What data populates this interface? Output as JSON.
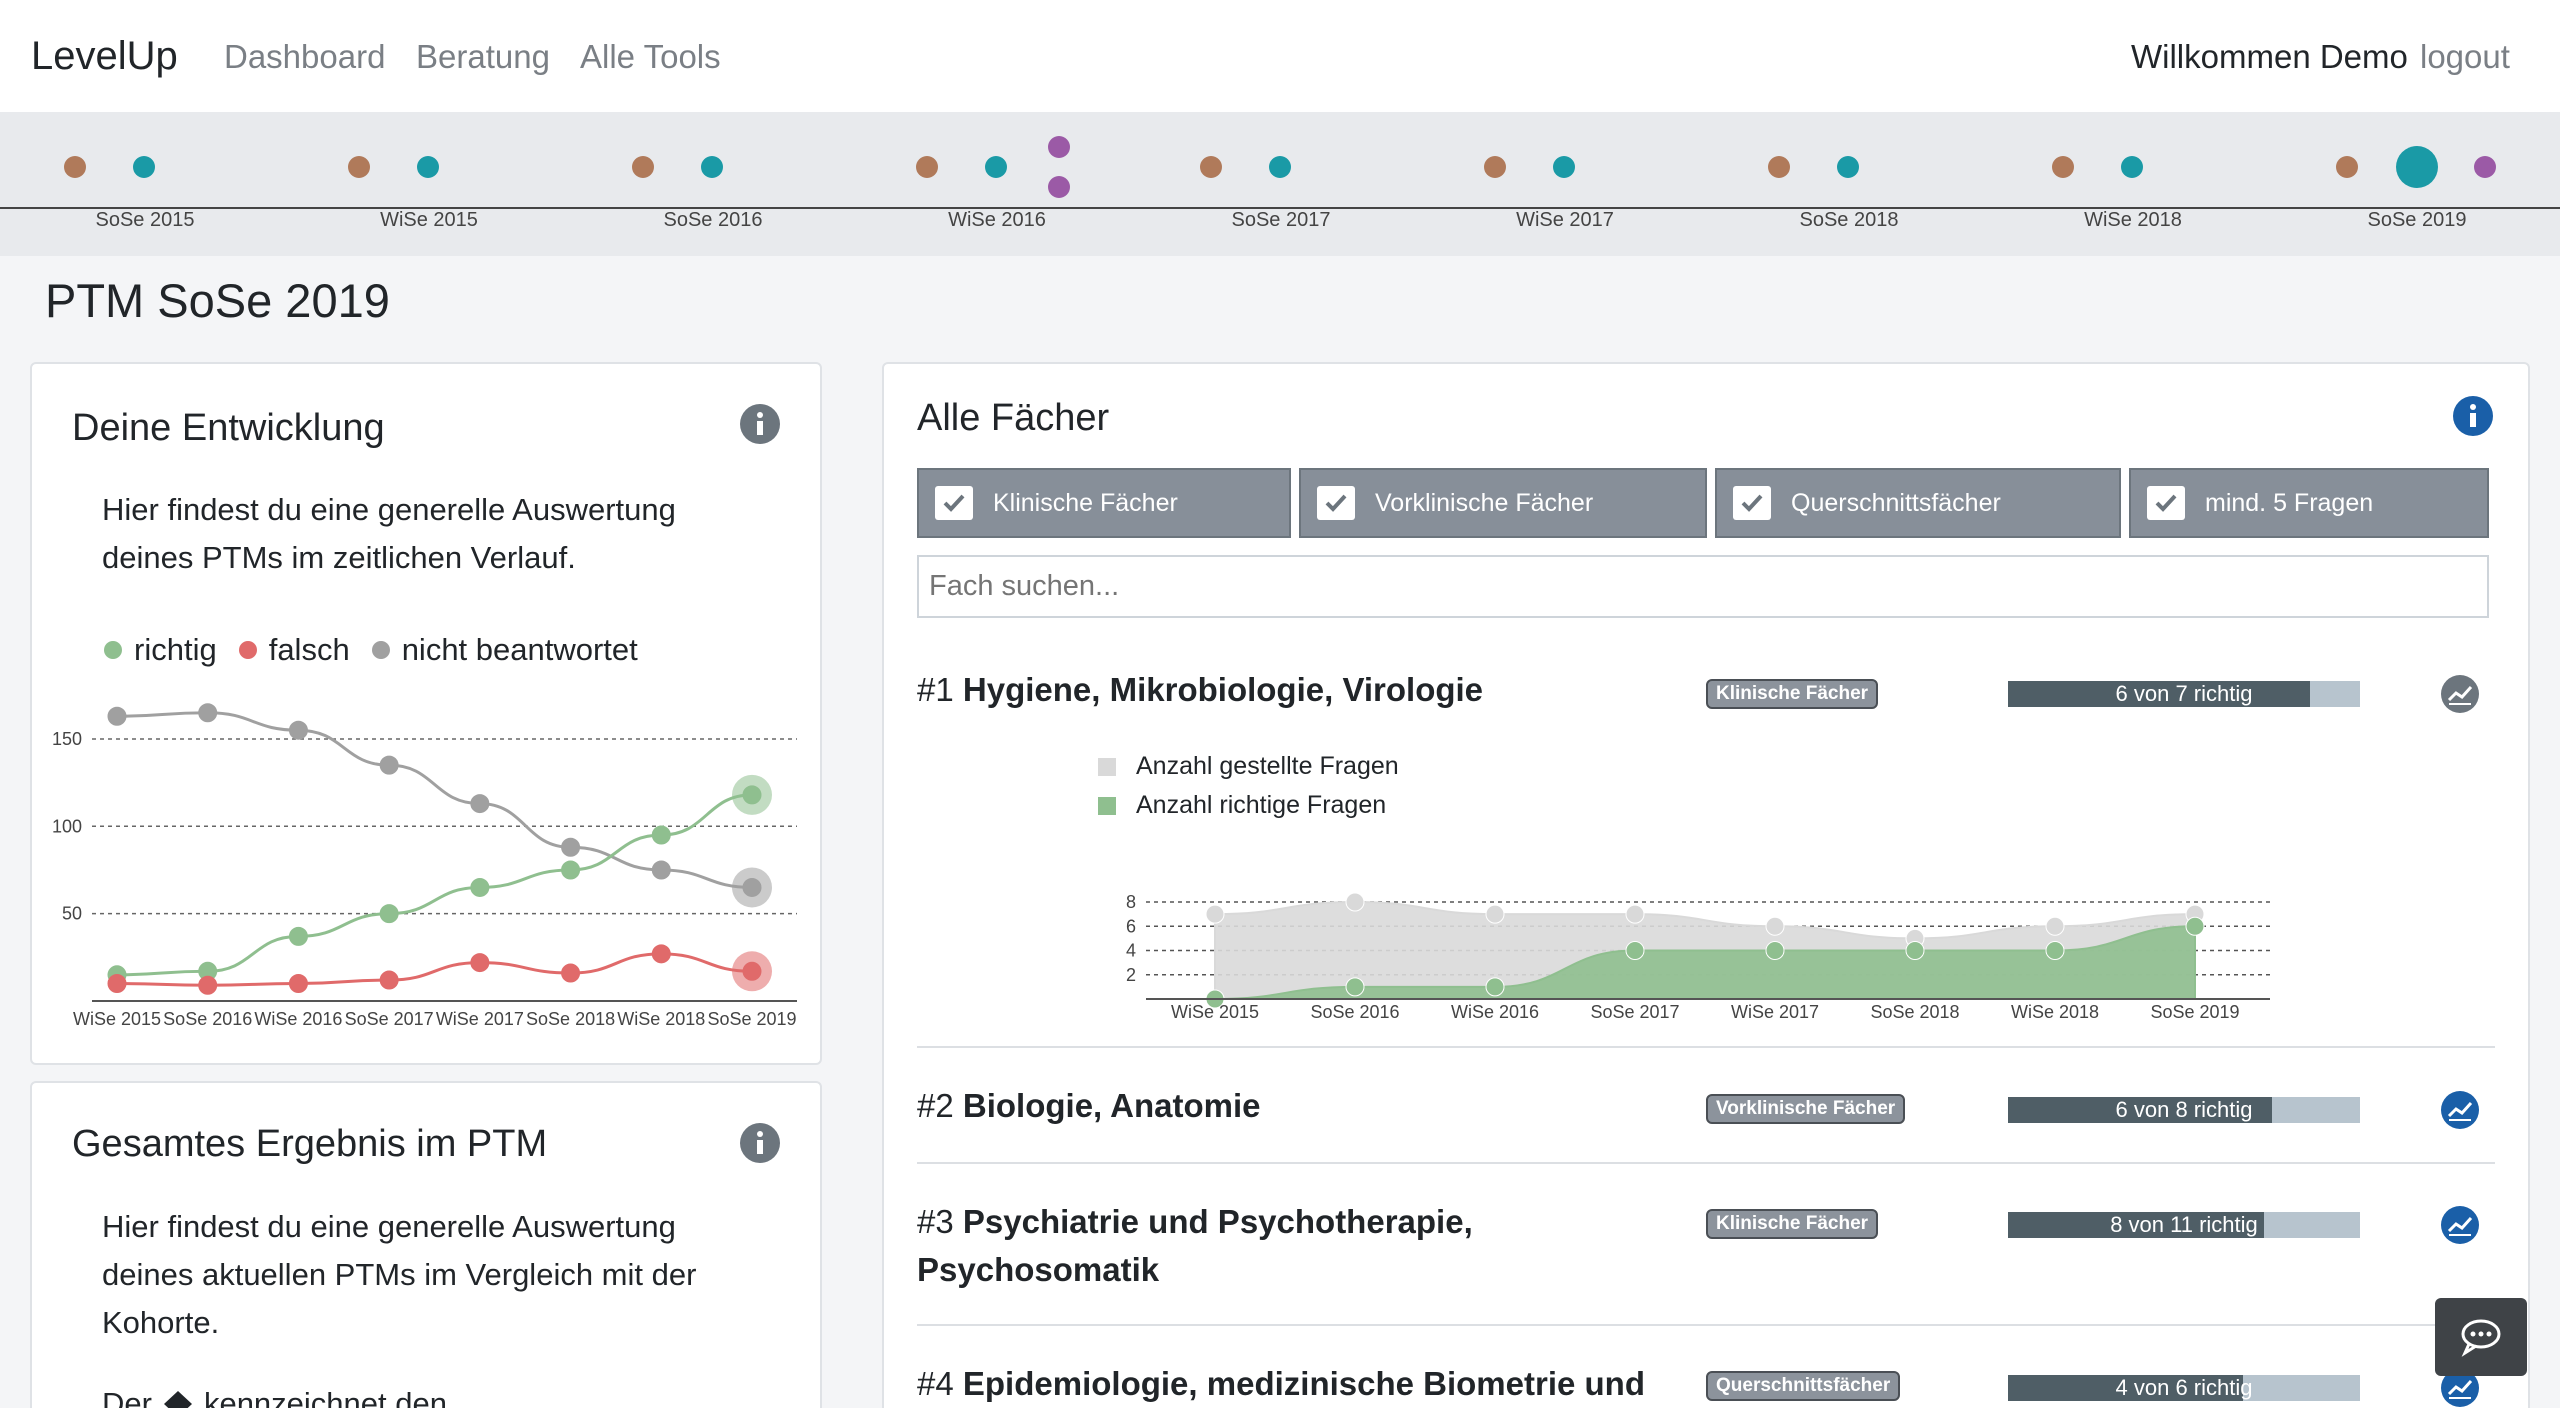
{
  "nav": {
    "brand": "LevelUp",
    "links": [
      "Dashboard",
      "Beratung",
      "Alle Tools"
    ],
    "welcome": "Willkommen Demo",
    "logout": "logout"
  },
  "timeline": {
    "semesters": [
      "SoSe 2015",
      "WiSe 2015",
      "SoSe 2016",
      "WiSe 2016",
      "SoSe 2017",
      "WiSe 2017",
      "SoSe 2018",
      "WiSe 2018",
      "SoSe 2019"
    ],
    "selected": "SoSe 2019",
    "colors": {
      "brown": "#b07a5a",
      "teal": "#1a9aa6",
      "purple": "#9b5aa6"
    }
  },
  "page_title": "PTM SoSe 2019",
  "development_card": {
    "title": "Deine Entwicklung",
    "description": "Hier findest du eine generelle Auswertung deines PTMs im zeitlichen Verlauf.",
    "legend": [
      {
        "label": "richtig",
        "color": "#8fbf8f"
      },
      {
        "label": "falsch",
        "color": "#e06a6a"
      },
      {
        "label": "nicht beantwortet",
        "color": "#a0a0a0"
      }
    ]
  },
  "total_card": {
    "title": "Gesamtes Ergebnis im PTM",
    "description": "Hier findest du eine generelle Auswertung deines aktuellen PTMs im Vergleich mit der Kohorte.",
    "partial_text": "Der",
    "partial_text_after": "kennzeichnet den"
  },
  "subjects_card": {
    "title": "Alle Fächer",
    "filters": [
      "Klinische Fächer",
      "Vorklinische Fächer",
      "Querschnittsfächer",
      "mind. 5 Fragen"
    ],
    "search_placeholder": "Fach suchen...",
    "subjects": [
      {
        "rank": "#1",
        "name": "Hygiene, Mikrobiologie, Virologie",
        "category": "Klinische Fächer",
        "progress_text": "6 von 7 richtig",
        "correct": 6,
        "total": 7
      },
      {
        "rank": "#2",
        "name": "Biologie, Anatomie",
        "category": "Vorklinische Fächer",
        "progress_text": "6 von 8 richtig",
        "correct": 6,
        "total": 8
      },
      {
        "rank": "#3",
        "name_line1": "Psychiatrie und Psychotherapie,",
        "name_line2": "Psychosomatik",
        "category": "Klinische Fächer",
        "progress_text": "8 von 11 richtig",
        "correct": 8,
        "total": 11
      },
      {
        "rank": "#4",
        "name": "Epidemiologie, medizinische Biometrie und",
        "category": "Querschnittsfächer",
        "progress_text": "4 von 6 richtig",
        "correct": 4,
        "total": 6
      }
    ],
    "detail_legend": [
      "Anzahl gestellte Fragen",
      "Anzahl richtige Fragen"
    ]
  },
  "chart_data": [
    {
      "type": "line",
      "title": "",
      "x": [
        "WiSe 2015",
        "SoSe 2016",
        "WiSe 2016",
        "SoSe 2017",
        "WiSe 2017",
        "SoSe 2018",
        "WiSe 2018",
        "SoSe 2019"
      ],
      "yticks": [
        50,
        100,
        150
      ],
      "ylim": [
        0,
        170
      ],
      "series": [
        {
          "name": "nicht beantwortet",
          "color": "#a0a0a0",
          "values": [
            163,
            165,
            155,
            135,
            113,
            88,
            75,
            65
          ]
        },
        {
          "name": "richtig",
          "color": "#8fbf8f",
          "values": [
            15,
            17,
            37,
            50,
            65,
            75,
            95,
            118
          ]
        },
        {
          "name": "falsch",
          "color": "#e06a6a",
          "values": [
            10,
            9,
            10,
            12,
            22,
            16,
            27,
            17
          ]
        }
      ]
    },
    {
      "type": "area",
      "title": "",
      "x": [
        "WiSe 2015",
        "SoSe 2016",
        "WiSe 2016",
        "SoSe 2017",
        "WiSe 2017",
        "SoSe 2018",
        "WiSe 2018",
        "SoSe 2019"
      ],
      "yticks": [
        2,
        4,
        6,
        8
      ],
      "ylim": [
        0,
        8
      ],
      "series": [
        {
          "name": "Anzahl gestellte Fragen",
          "color": "#d9d9d9",
          "values": [
            7,
            8,
            7,
            7,
            6,
            5,
            6,
            7
          ]
        },
        {
          "name": "Anzahl richtige Fragen",
          "color": "#8fbf8f",
          "values": [
            0,
            1,
            1,
            4,
            4,
            4,
            4,
            6
          ]
        }
      ]
    }
  ]
}
